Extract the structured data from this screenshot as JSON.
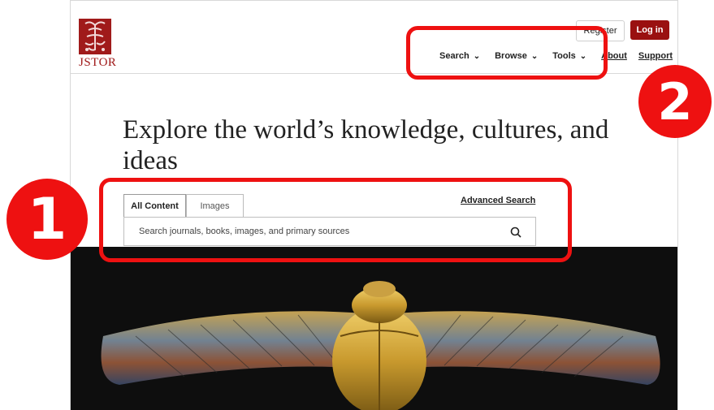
{
  "header": {
    "logo_text": "JSTOR",
    "register_label": "Register",
    "login_label": "Log in",
    "nav": [
      {
        "label": "Search"
      },
      {
        "label": "Browse"
      },
      {
        "label": "Tools"
      }
    ],
    "about_label": "About",
    "support_label": "Support"
  },
  "hero": {
    "headline": "Explore the world’s knowledge, cultures, and ideas",
    "tabs": [
      {
        "label": "All Content",
        "active": true
      },
      {
        "label": "Images",
        "active": false
      }
    ],
    "advanced_search_label": "Advanced Search",
    "search_placeholder": "Search journals, books, images, and primary sources"
  },
  "annotations": {
    "badge_1": "1",
    "badge_2": "2"
  },
  "colors": {
    "brand": "#9a1010",
    "annotation": "#ee1111"
  }
}
